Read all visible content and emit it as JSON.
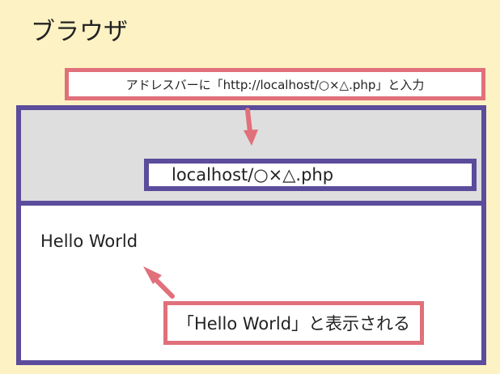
{
  "title": "ブラウザ",
  "top_callout": {
    "text": "アドレスバーに「http://localhost/○×△.php」と入力"
  },
  "browser": {
    "address_bar_url": "localhost/○×△.php",
    "page_content": "Hello World"
  },
  "bottom_callout": {
    "text": "「Hello World」と表示される"
  },
  "colors": {
    "background": "#fdf2c4",
    "browser_border": "#5b4c9c",
    "toolbar": "#dedede",
    "callout_border": "#e0707a",
    "arrow": "#e0707a"
  }
}
